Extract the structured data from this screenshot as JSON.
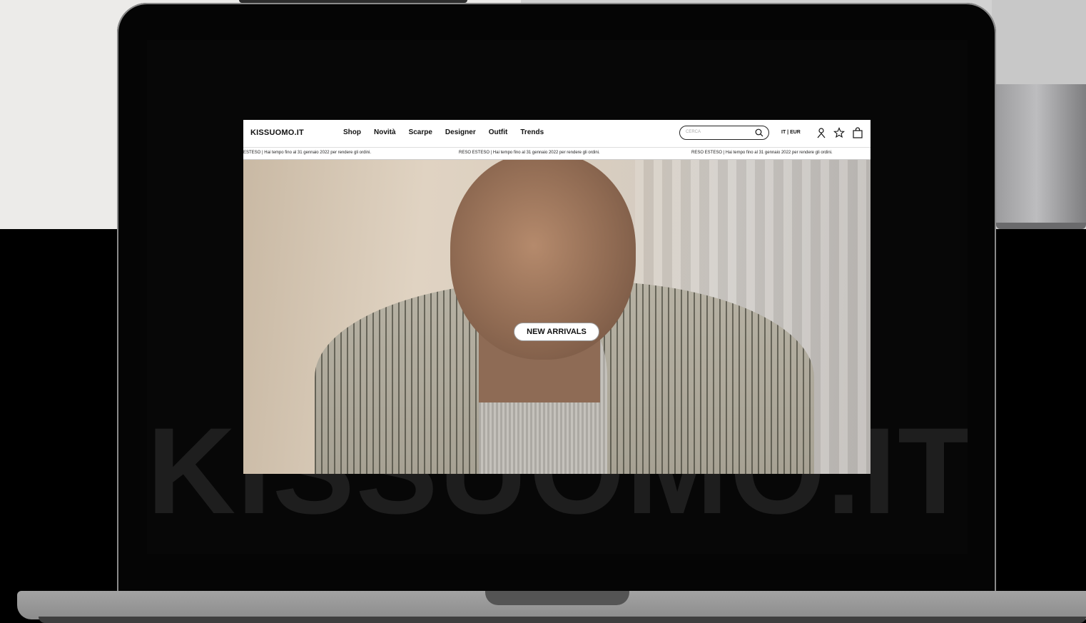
{
  "site": {
    "logo": "KISSUOMO.IT",
    "nav": [
      "Shop",
      "Novità",
      "Scarpe",
      "Designer",
      "Outfit",
      "Trends"
    ],
    "search": {
      "placeholder": "CERCA"
    },
    "locale": "IT | EUR",
    "icons": [
      "search-icon",
      "user-icon",
      "star-icon",
      "shopping-bag-icon"
    ],
    "ticker": [
      "ESTESO | Hai tempo fino al 31 gennaio 2022 per rendere gli ordini.",
      "RESO ESTESO | Hai tempo fino al 31 gennaio 2022 per rendere gli ordini.",
      "RESO ESTESO | Hai tempo fino al 31 gennaio 2022 per rendere gli ordini."
    ],
    "hero_cta": "NEW ARRIVALS"
  },
  "watermark": "KISSUOMO.IT"
}
